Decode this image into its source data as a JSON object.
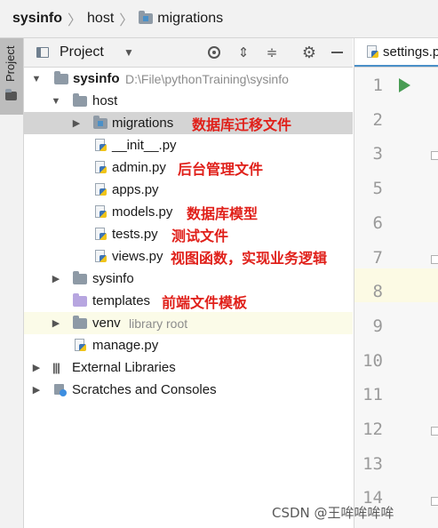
{
  "breadcrumb": {
    "root": "sysinfo",
    "item2": "host",
    "item3": "migrations"
  },
  "stripe": {
    "label": "Project"
  },
  "panel": {
    "title": "Project",
    "dropdown_glyph": "▼"
  },
  "tree": {
    "sysinfo_root": {
      "label": "sysinfo",
      "path": "D:\\File\\pythonTraining\\sysinfo"
    },
    "host": {
      "label": "host"
    },
    "migrations": {
      "label": "migrations"
    },
    "init": {
      "label": "__init__.py"
    },
    "admin": {
      "label": "admin.py"
    },
    "apps": {
      "label": "apps.py"
    },
    "models": {
      "label": "models.py"
    },
    "tests": {
      "label": "tests.py"
    },
    "views": {
      "label": "views.py"
    },
    "sysinfo_pkg": {
      "label": "sysinfo"
    },
    "templates": {
      "label": "templates"
    },
    "venv": {
      "label": "venv",
      "note": "library root"
    },
    "manage": {
      "label": "manage.py"
    },
    "external_libraries": {
      "label": "External Libraries"
    },
    "scratches": {
      "label": "Scratches and Consoles"
    }
  },
  "annotations": {
    "migrations": "数据库迁移文件",
    "admin": "后台管理文件",
    "models": "数据库模型",
    "tests": "测试文件",
    "views": "视图函数，实现业务逻辑",
    "templates": "前端文件模板"
  },
  "editor": {
    "tab_label": "settings.py",
    "line_numbers": [
      "1",
      "2",
      "3",
      "5",
      "6",
      "7",
      "8",
      "9",
      "10",
      "11",
      "12",
      "13",
      "14"
    ]
  },
  "icons": {
    "arrow_expanded": "▼",
    "arrow_collapsed": "▶",
    "separator": "〉",
    "gear": "⚙",
    "expand_all": "⇕",
    "collapse_all": "≑"
  },
  "watermark": "CSDN @王哞哞哞哞",
  "colors": {
    "annotation": "#e0201a",
    "selection": "#d4d4d4",
    "run": "#499c54"
  }
}
